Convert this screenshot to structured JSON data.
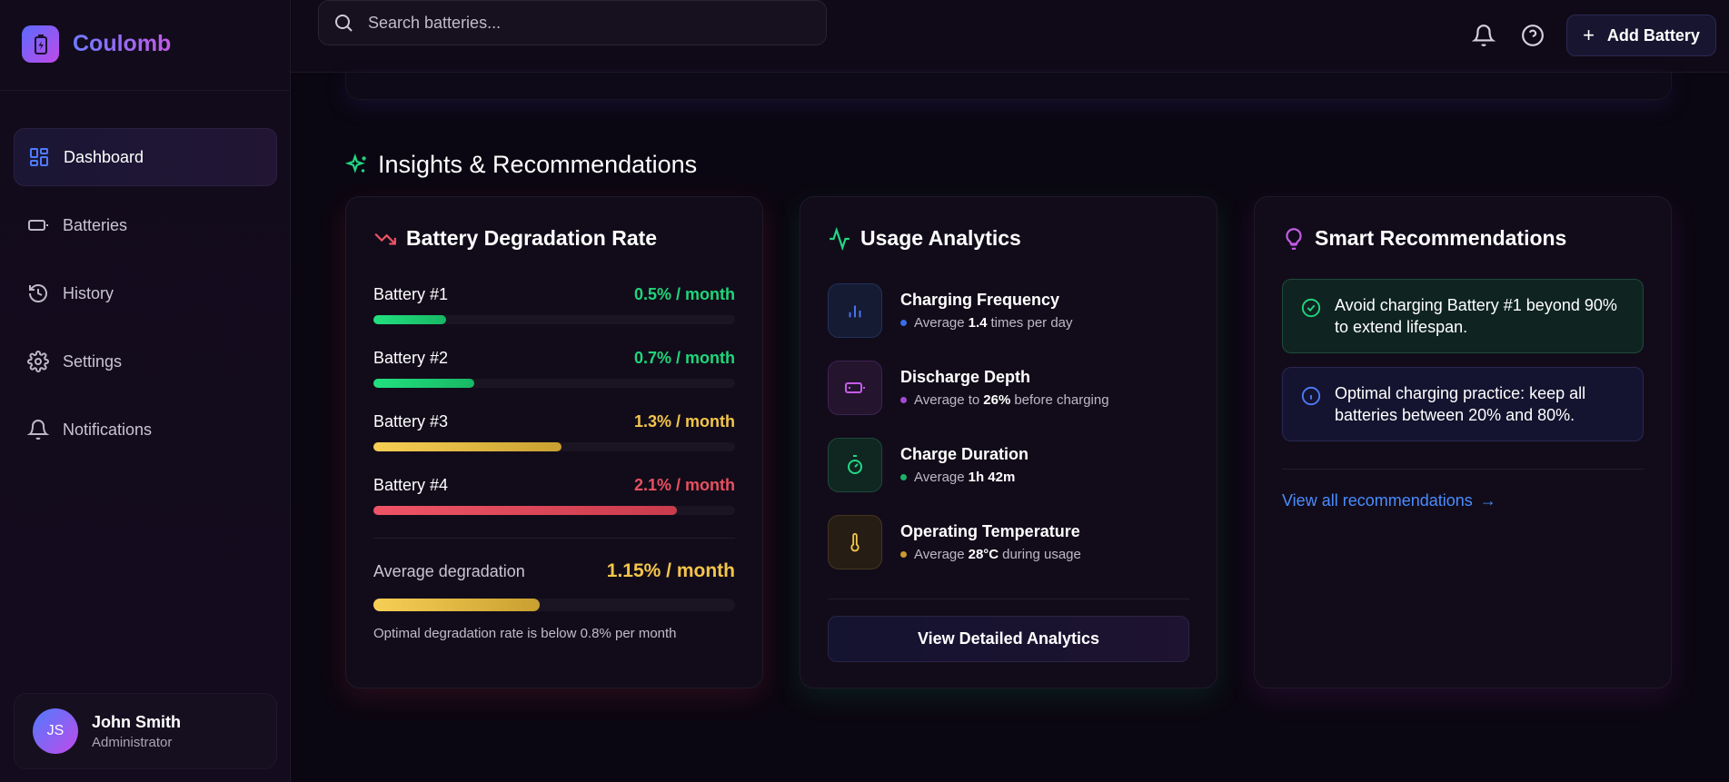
{
  "brand": {
    "name": "Coulomb",
    "logo_icon": "battery-charging-icon"
  },
  "sidebar": {
    "items": [
      {
        "label": "Dashboard",
        "icon": "dashboard-icon",
        "active": true
      },
      {
        "label": "Batteries",
        "icon": "battery-icon",
        "active": false
      },
      {
        "label": "History",
        "icon": "history-icon",
        "active": false
      },
      {
        "label": "Settings",
        "icon": "gear-icon",
        "active": false
      },
      {
        "label": "Notifications",
        "icon": "bell-icon",
        "active": false
      }
    ],
    "user": {
      "initials": "JS",
      "name": "John Smith",
      "role": "Administrator"
    }
  },
  "header": {
    "search_placeholder": "Search batteries...",
    "add_button_label": "Add Battery"
  },
  "insights": {
    "title": "Insights & Recommendations",
    "degradation": {
      "title": "Battery Degradation Rate",
      "batteries": [
        {
          "name": "Battery #1",
          "rate": "0.5% / month",
          "level": 0.2,
          "color": "#1fd67a"
        },
        {
          "name": "Battery #2",
          "rate": "0.7% / month",
          "level": 0.28,
          "color": "#1fd67a"
        },
        {
          "name": "Battery #3",
          "rate": "1.3% / month",
          "level": 0.52,
          "color": "#f3c54b"
        },
        {
          "name": "Battery #4",
          "rate": "2.1% / month",
          "level": 0.84,
          "color": "#e8505f"
        }
      ],
      "average_label": "Average degradation",
      "average_value": "1.15% / month",
      "average_level": 0.46,
      "note": "Optimal degradation rate is below 0.8% per month"
    },
    "usage": {
      "title": "Usage Analytics",
      "metrics": [
        {
          "title": "Charging Frequency",
          "prefix": "Average",
          "value": "1.4",
          "suffix": "times per day",
          "icon": "bar-chart-icon"
        },
        {
          "title": "Discharge Depth",
          "prefix": "Average to",
          "value": "26%",
          "suffix": "before charging",
          "icon": "battery-low-icon"
        },
        {
          "title": "Charge Duration",
          "prefix": "Average",
          "value": "1h 42m",
          "suffix": "",
          "icon": "timer-icon"
        },
        {
          "title": "Operating Temperature",
          "prefix": "Average",
          "value": "28°C",
          "suffix": "during usage",
          "icon": "thermometer-icon"
        }
      ],
      "button_label": "View Detailed Analytics"
    },
    "recommendations": {
      "title": "Smart Recommendations",
      "items": [
        {
          "text": "Avoid charging Battery #1 beyond 90% to extend lifespan.",
          "icon": "check-circle-icon"
        },
        {
          "text": "Optimal charging practice: keep all batteries between 20% and 80%.",
          "icon": "info-icon"
        }
      ],
      "link_label": "View all recommendations",
      "link_arrow": "→"
    }
  }
}
